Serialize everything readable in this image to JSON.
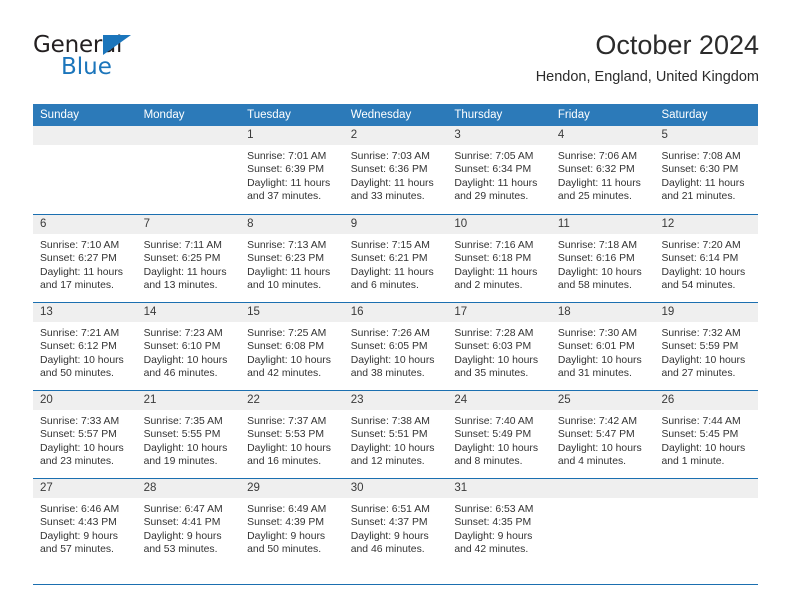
{
  "brand": {
    "name_part1": "General",
    "name_part2": "Blue",
    "accent_color": "#1b75bb"
  },
  "header": {
    "month_title": "October 2024",
    "location": "Hendon, England, United Kingdom"
  },
  "theme": {
    "header_row_bg": "#2c7ab9",
    "row_divider": "#1b6fb0",
    "date_strip_bg": "#efefef",
    "text_color": "#333333"
  },
  "calendar": {
    "weekday_headers": [
      "Sunday",
      "Monday",
      "Tuesday",
      "Wednesday",
      "Thursday",
      "Friday",
      "Saturday"
    ],
    "weeks": [
      [
        {
          "empty": true
        },
        {
          "empty": true
        },
        {
          "day": "1",
          "sunrise": "Sunrise: 7:01 AM",
          "sunset": "Sunset: 6:39 PM",
          "daylight_line1": "Daylight: 11 hours",
          "daylight_line2": "and 37 minutes."
        },
        {
          "day": "2",
          "sunrise": "Sunrise: 7:03 AM",
          "sunset": "Sunset: 6:36 PM",
          "daylight_line1": "Daylight: 11 hours",
          "daylight_line2": "and 33 minutes."
        },
        {
          "day": "3",
          "sunrise": "Sunrise: 7:05 AM",
          "sunset": "Sunset: 6:34 PM",
          "daylight_line1": "Daylight: 11 hours",
          "daylight_line2": "and 29 minutes."
        },
        {
          "day": "4",
          "sunrise": "Sunrise: 7:06 AM",
          "sunset": "Sunset: 6:32 PM",
          "daylight_line1": "Daylight: 11 hours",
          "daylight_line2": "and 25 minutes."
        },
        {
          "day": "5",
          "sunrise": "Sunrise: 7:08 AM",
          "sunset": "Sunset: 6:30 PM",
          "daylight_line1": "Daylight: 11 hours",
          "daylight_line2": "and 21 minutes."
        }
      ],
      [
        {
          "day": "6",
          "sunrise": "Sunrise: 7:10 AM",
          "sunset": "Sunset: 6:27 PM",
          "daylight_line1": "Daylight: 11 hours",
          "daylight_line2": "and 17 minutes."
        },
        {
          "day": "7",
          "sunrise": "Sunrise: 7:11 AM",
          "sunset": "Sunset: 6:25 PM",
          "daylight_line1": "Daylight: 11 hours",
          "daylight_line2": "and 13 minutes."
        },
        {
          "day": "8",
          "sunrise": "Sunrise: 7:13 AM",
          "sunset": "Sunset: 6:23 PM",
          "daylight_line1": "Daylight: 11 hours",
          "daylight_line2": "and 10 minutes."
        },
        {
          "day": "9",
          "sunrise": "Sunrise: 7:15 AM",
          "sunset": "Sunset: 6:21 PM",
          "daylight_line1": "Daylight: 11 hours",
          "daylight_line2": "and 6 minutes."
        },
        {
          "day": "10",
          "sunrise": "Sunrise: 7:16 AM",
          "sunset": "Sunset: 6:18 PM",
          "daylight_line1": "Daylight: 11 hours",
          "daylight_line2": "and 2 minutes."
        },
        {
          "day": "11",
          "sunrise": "Sunrise: 7:18 AM",
          "sunset": "Sunset: 6:16 PM",
          "daylight_line1": "Daylight: 10 hours",
          "daylight_line2": "and 58 minutes."
        },
        {
          "day": "12",
          "sunrise": "Sunrise: 7:20 AM",
          "sunset": "Sunset: 6:14 PM",
          "daylight_line1": "Daylight: 10 hours",
          "daylight_line2": "and 54 minutes."
        }
      ],
      [
        {
          "day": "13",
          "sunrise": "Sunrise: 7:21 AM",
          "sunset": "Sunset: 6:12 PM",
          "daylight_line1": "Daylight: 10 hours",
          "daylight_line2": "and 50 minutes."
        },
        {
          "day": "14",
          "sunrise": "Sunrise: 7:23 AM",
          "sunset": "Sunset: 6:10 PM",
          "daylight_line1": "Daylight: 10 hours",
          "daylight_line2": "and 46 minutes."
        },
        {
          "day": "15",
          "sunrise": "Sunrise: 7:25 AM",
          "sunset": "Sunset: 6:08 PM",
          "daylight_line1": "Daylight: 10 hours",
          "daylight_line2": "and 42 minutes."
        },
        {
          "day": "16",
          "sunrise": "Sunrise: 7:26 AM",
          "sunset": "Sunset: 6:05 PM",
          "daylight_line1": "Daylight: 10 hours",
          "daylight_line2": "and 38 minutes."
        },
        {
          "day": "17",
          "sunrise": "Sunrise: 7:28 AM",
          "sunset": "Sunset: 6:03 PM",
          "daylight_line1": "Daylight: 10 hours",
          "daylight_line2": "and 35 minutes."
        },
        {
          "day": "18",
          "sunrise": "Sunrise: 7:30 AM",
          "sunset": "Sunset: 6:01 PM",
          "daylight_line1": "Daylight: 10 hours",
          "daylight_line2": "and 31 minutes."
        },
        {
          "day": "19",
          "sunrise": "Sunrise: 7:32 AM",
          "sunset": "Sunset: 5:59 PM",
          "daylight_line1": "Daylight: 10 hours",
          "daylight_line2": "and 27 minutes."
        }
      ],
      [
        {
          "day": "20",
          "sunrise": "Sunrise: 7:33 AM",
          "sunset": "Sunset: 5:57 PM",
          "daylight_line1": "Daylight: 10 hours",
          "daylight_line2": "and 23 minutes."
        },
        {
          "day": "21",
          "sunrise": "Sunrise: 7:35 AM",
          "sunset": "Sunset: 5:55 PM",
          "daylight_line1": "Daylight: 10 hours",
          "daylight_line2": "and 19 minutes."
        },
        {
          "day": "22",
          "sunrise": "Sunrise: 7:37 AM",
          "sunset": "Sunset: 5:53 PM",
          "daylight_line1": "Daylight: 10 hours",
          "daylight_line2": "and 16 minutes."
        },
        {
          "day": "23",
          "sunrise": "Sunrise: 7:38 AM",
          "sunset": "Sunset: 5:51 PM",
          "daylight_line1": "Daylight: 10 hours",
          "daylight_line2": "and 12 minutes."
        },
        {
          "day": "24",
          "sunrise": "Sunrise: 7:40 AM",
          "sunset": "Sunset: 5:49 PM",
          "daylight_line1": "Daylight: 10 hours",
          "daylight_line2": "and 8 minutes."
        },
        {
          "day": "25",
          "sunrise": "Sunrise: 7:42 AM",
          "sunset": "Sunset: 5:47 PM",
          "daylight_line1": "Daylight: 10 hours",
          "daylight_line2": "and 4 minutes."
        },
        {
          "day": "26",
          "sunrise": "Sunrise: 7:44 AM",
          "sunset": "Sunset: 5:45 PM",
          "daylight_line1": "Daylight: 10 hours",
          "daylight_line2": "and 1 minute."
        }
      ],
      [
        {
          "day": "27",
          "sunrise": "Sunrise: 6:46 AM",
          "sunset": "Sunset: 4:43 PM",
          "daylight_line1": "Daylight: 9 hours",
          "daylight_line2": "and 57 minutes."
        },
        {
          "day": "28",
          "sunrise": "Sunrise: 6:47 AM",
          "sunset": "Sunset: 4:41 PM",
          "daylight_line1": "Daylight: 9 hours",
          "daylight_line2": "and 53 minutes."
        },
        {
          "day": "29",
          "sunrise": "Sunrise: 6:49 AM",
          "sunset": "Sunset: 4:39 PM",
          "daylight_line1": "Daylight: 9 hours",
          "daylight_line2": "and 50 minutes."
        },
        {
          "day": "30",
          "sunrise": "Sunrise: 6:51 AM",
          "sunset": "Sunset: 4:37 PM",
          "daylight_line1": "Daylight: 9 hours",
          "daylight_line2": "and 46 minutes."
        },
        {
          "day": "31",
          "sunrise": "Sunrise: 6:53 AM",
          "sunset": "Sunset: 4:35 PM",
          "daylight_line1": "Daylight: 9 hours",
          "daylight_line2": "and 42 minutes."
        },
        {
          "empty": true
        },
        {
          "empty": true
        }
      ]
    ]
  }
}
